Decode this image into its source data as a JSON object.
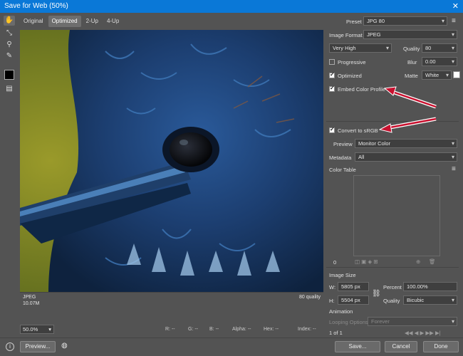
{
  "window": {
    "title": "Save for Web (50%)",
    "close": "✕"
  },
  "tabs": [
    "Original",
    "Optimized",
    "2-Up",
    "4-Up"
  ],
  "preview_info": {
    "format": "JPEG",
    "size": "10.07M",
    "quality": "80 quality"
  },
  "panel": {
    "preset_label": "Preset",
    "preset_value": "JPG 80",
    "image_format_label": "Image Format",
    "image_format_value": "JPEG",
    "compression_value": "Very High",
    "quality_label": "Quality",
    "quality_value": "80",
    "progressive_label": "Progressive",
    "blur_label": "Blur",
    "blur_value": "0.00",
    "optimized_label": "Optimized",
    "matte_label": "Matte",
    "matte_value": "White",
    "embed_label": "Embed Color Profile",
    "convert_label": "Convert to sRGB",
    "preview_label": "Preview",
    "preview_value": "Monitor Color",
    "metadata_label": "Metadata",
    "metadata_value": "All",
    "color_table_label": "Color Table",
    "color_count": "0",
    "image_size_label": "Image Size",
    "w_label": "W:",
    "w_value": "5805 px",
    "h_label": "H:",
    "h_value": "5504 px",
    "percent_label": "Percent",
    "percent_value": "100.00%",
    "resample_label": "Quality",
    "resample_value": "Bicubic",
    "animation_label": "Animation",
    "looping_label": "Looping Options",
    "looping_value": "Forever",
    "frame_count": "1 of 1"
  },
  "statusbar": {
    "zoom": "50.0%",
    "r": "R:",
    "r_val": "--",
    "g": "G:",
    "g_val": "--",
    "b": "B:",
    "b_val": "--",
    "alpha": "Alpha:",
    "alpha_val": "--",
    "hex": "Hex:",
    "hex_val": "--",
    "index": "Index:",
    "index_val": "--"
  },
  "buttons": {
    "preview": "Preview...",
    "save": "Save...",
    "cancel": "Cancel",
    "done": "Done"
  },
  "icons": [
    "hand-icon",
    "slice-select-icon",
    "zoom-icon",
    "eyedropper-icon",
    "color-swatch",
    "slice-visibility-icon",
    "menu-icon",
    "info-icon",
    "browser-globe-icon"
  ]
}
